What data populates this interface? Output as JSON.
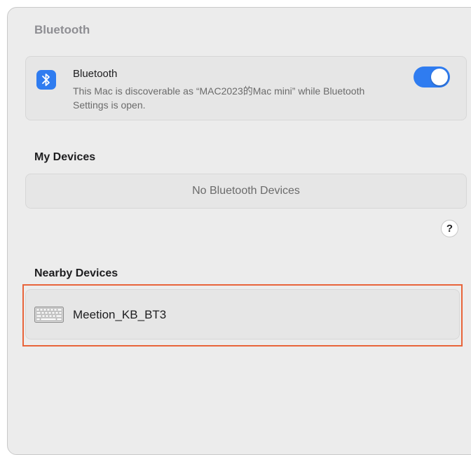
{
  "pane": {
    "title": "Bluetooth"
  },
  "bluetooth": {
    "title": "Bluetooth",
    "description": "This Mac is discoverable as “MAC2023的Mac mini” while Bluetooth Settings is open.",
    "enabled": true,
    "icon": "bluetooth-icon",
    "accent_color": "#2f7cf0"
  },
  "my_devices": {
    "title": "My Devices",
    "empty_text": "No Bluetooth Devices"
  },
  "help": {
    "label": "?"
  },
  "nearby_devices": {
    "title": "Nearby Devices",
    "items": [
      {
        "name": "Meetion_KB_BT3",
        "icon": "keyboard-icon"
      }
    ],
    "highlight_color": "#e8643a"
  }
}
